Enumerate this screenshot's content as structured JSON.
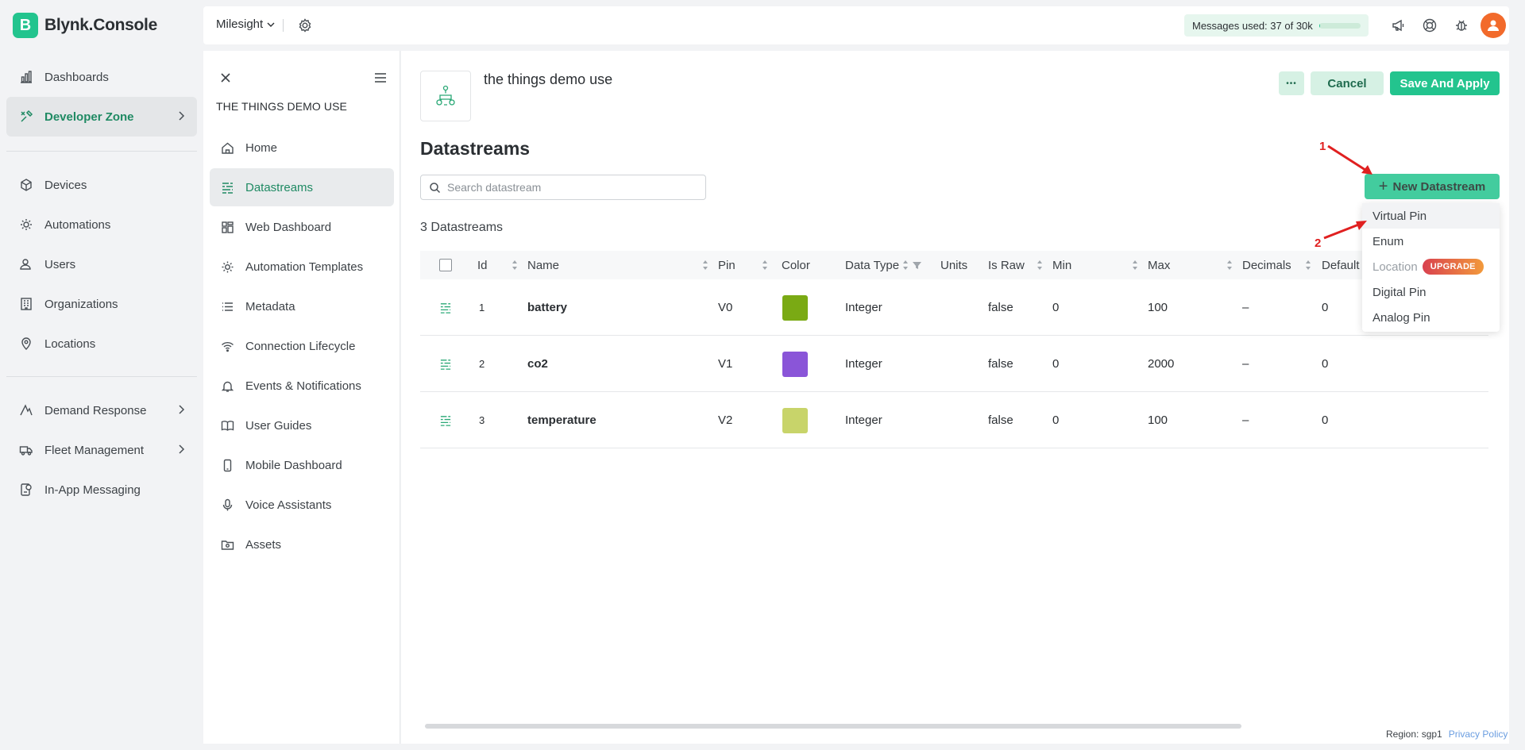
{
  "app": {
    "logo_letter": "B",
    "logo_text": "Blynk.Console",
    "accent": "#23c48e"
  },
  "nav": {
    "items": [
      {
        "label": "Dashboards",
        "icon": "chart-icon"
      },
      {
        "label": "Developer Zone",
        "icon": "tools-icon",
        "active": true,
        "has_children": true
      },
      {
        "label": "Devices",
        "icon": "cube-icon"
      },
      {
        "label": "Automations",
        "icon": "automation-icon"
      },
      {
        "label": "Users",
        "icon": "users-icon"
      },
      {
        "label": "Organizations",
        "icon": "building-icon"
      },
      {
        "label": "Locations",
        "icon": "pin-icon"
      },
      {
        "label": "Demand Response",
        "icon": "demand-icon",
        "has_children": true
      },
      {
        "label": "Fleet Management",
        "icon": "truck-icon",
        "has_children": true
      },
      {
        "label": "In-App Messaging",
        "icon": "message-icon"
      }
    ]
  },
  "topbar": {
    "org_name": "Milesight",
    "messages_label": "Messages used:",
    "messages_value": "37 of 30k",
    "messages_fraction": 0.0012
  },
  "template": {
    "title_caps": "THE THINGS DEMO USE",
    "name": "the things demo use",
    "nav": [
      {
        "label": "Home",
        "icon": "home-icon"
      },
      {
        "label": "Datastreams",
        "icon": "datastream-icon",
        "active": true
      },
      {
        "label": "Web Dashboard",
        "icon": "web-dashboard-icon"
      },
      {
        "label": "Automation Templates",
        "icon": "automation-icon"
      },
      {
        "label": "Metadata",
        "icon": "list-icon"
      },
      {
        "label": "Connection Lifecycle",
        "icon": "wifi-icon"
      },
      {
        "label": "Events & Notifications",
        "icon": "bell-icon"
      },
      {
        "label": "User Guides",
        "icon": "book-icon"
      },
      {
        "label": "Mobile Dashboard",
        "icon": "mobile-icon"
      },
      {
        "label": "Voice Assistants",
        "icon": "mic-icon"
      },
      {
        "label": "Assets",
        "icon": "folder-icon"
      }
    ]
  },
  "actions": {
    "more": "•••",
    "cancel": "Cancel",
    "save": "Save And Apply",
    "new_datastream": "New Datastream"
  },
  "datastreams": {
    "heading": "Datastreams",
    "search_placeholder": "Search datastream",
    "count_label": "3 Datastreams",
    "columns": [
      "Id",
      "Name",
      "Pin",
      "Color",
      "Data Type",
      "Units",
      "Is Raw",
      "Min",
      "Max",
      "Decimals",
      "Default V"
    ],
    "rows": [
      {
        "id": "1",
        "name": "battery",
        "pin": "V0",
        "color": "#7aaa14",
        "data_type": "Integer",
        "units": "",
        "is_raw": "false",
        "min": "0",
        "max": "100",
        "decimals": "–",
        "default": "0"
      },
      {
        "id": "2",
        "name": "co2",
        "pin": "V1",
        "color": "#8a55d8",
        "data_type": "Integer",
        "units": "",
        "is_raw": "false",
        "min": "0",
        "max": "2000",
        "decimals": "–",
        "default": "0"
      },
      {
        "id": "3",
        "name": "temperature",
        "pin": "V2",
        "color": "#c8d46a",
        "data_type": "Integer",
        "units": "",
        "is_raw": "false",
        "min": "0",
        "max": "100",
        "decimals": "–",
        "default": "0"
      }
    ]
  },
  "new_menu": {
    "items": [
      {
        "label": "Virtual Pin"
      },
      {
        "label": "Enum"
      },
      {
        "label": "Location",
        "disabled": true,
        "badge": "UPGRADE"
      },
      {
        "label": "Digital Pin"
      },
      {
        "label": "Analog Pin"
      }
    ]
  },
  "annotations": {
    "step1": "1",
    "step2": "2",
    "color": "#e02020"
  },
  "footer": {
    "region": "Region: sgp1",
    "privacy": "Privacy Policy"
  }
}
